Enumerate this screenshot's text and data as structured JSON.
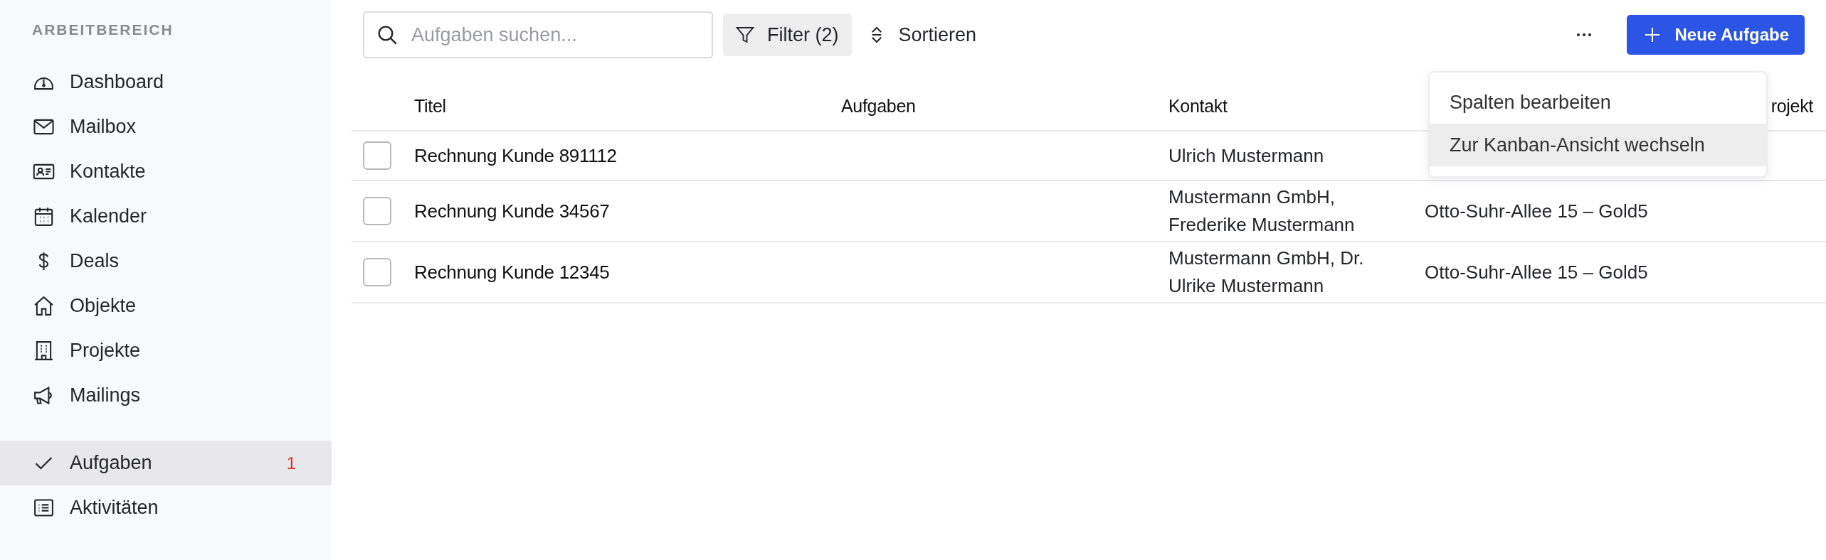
{
  "sidebar": {
    "section_label": "ARBEITBEREICH",
    "groups": [
      {
        "items": [
          {
            "label": "Dashboard",
            "kind": "gauge",
            "selected": false
          },
          {
            "label": "Mailbox",
            "kind": "envelope",
            "selected": false
          },
          {
            "label": "Kontakte",
            "kind": "contact-card",
            "selected": false
          },
          {
            "label": "Kalender",
            "kind": "calendar",
            "selected": false
          },
          {
            "label": "Deals",
            "kind": "dollar",
            "selected": false
          },
          {
            "label": "Objekte",
            "kind": "house",
            "selected": false
          },
          {
            "label": "Projekte",
            "kind": "building",
            "selected": false
          },
          {
            "label": "Mailings",
            "kind": "megaphone",
            "selected": false
          }
        ]
      },
      {
        "items": [
          {
            "label": "Aufgaben",
            "kind": "check",
            "selected": true,
            "badge": "1"
          },
          {
            "label": "Aktivitäten",
            "kind": "list",
            "selected": false
          }
        ]
      }
    ]
  },
  "toolbar": {
    "search": {
      "placeholder": "Aufgaben suchen..."
    },
    "filter": "Filter (2)",
    "sort": "Sortieren",
    "new_button": "Neue Aufgabe"
  },
  "table": {
    "columns": [
      {
        "label": "Titel"
      },
      {
        "label": "Aufgaben"
      },
      {
        "label": "Kontakt"
      },
      {
        "kind": "covered"
      },
      {
        "label": "rojekt"
      }
    ],
    "rows": [
      {
        "checked": false,
        "title": "Rechnung Kunde 891112",
        "contact": "Ulrich Mustermann"
      },
      {
        "checked": false,
        "title": "Rechnung Kunde 34567",
        "contact": "Mustermann GmbH, Frederike Mustermann",
        "column_4": "Otto-Suhr-Allee 15 – Gold5"
      },
      {
        "checked": false,
        "title": "Rechnung Kunde 12345",
        "contact": "Mustermann GmbH, Dr. Ulrike Mustermann",
        "column_4": "Otto-Suhr-Allee 15 – Gold5"
      }
    ]
  },
  "menu": {
    "items": [
      {
        "label": "Spalten bearbeiten",
        "highlighted": false
      },
      {
        "label": "Zur Kanban-Ansicht wechseln",
        "highlighted": true
      }
    ]
  }
}
